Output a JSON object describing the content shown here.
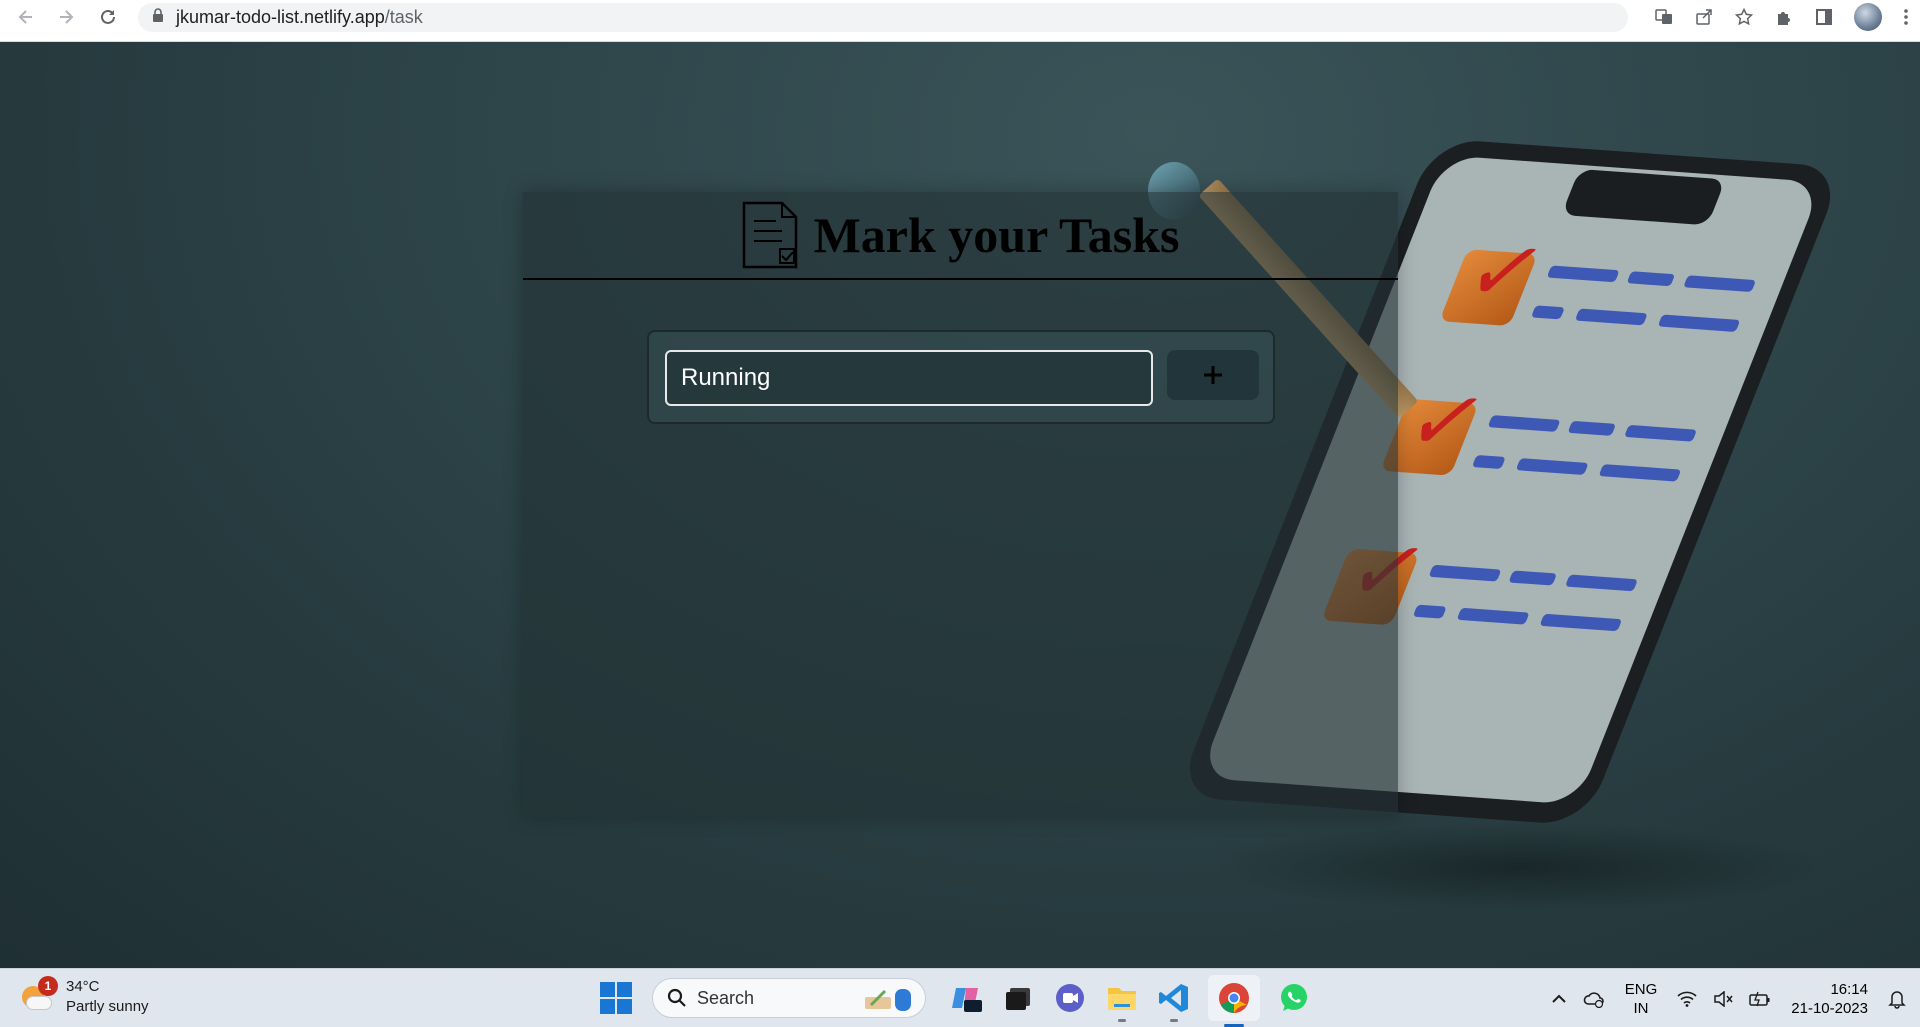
{
  "browser": {
    "url_host": "jkumar-todo-list.netlify.app",
    "url_path": "/task",
    "icons": [
      "back-icon",
      "forward-icon",
      "reload-icon",
      "lock-icon",
      "translate-icon",
      "share-icon",
      "star-icon",
      "extensions-icon",
      "side-panel-icon",
      "profile-avatar",
      "more-icon"
    ]
  },
  "app": {
    "title": "Mark your Tasks",
    "input_value": "Running",
    "add_button_label": "+",
    "colors": {
      "title": "#000000",
      "input_border": "#e8e8e8"
    }
  },
  "taskbar": {
    "weather": {
      "badge": "1",
      "temperature": "34°C",
      "condition": "Partly sunny"
    },
    "search_label": "Search",
    "language": {
      "line1": "ENG",
      "line2": "IN"
    },
    "clock": {
      "time": "16:14",
      "date": "21-10-2023"
    }
  }
}
